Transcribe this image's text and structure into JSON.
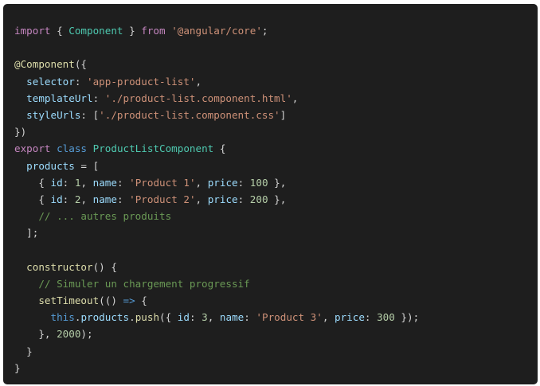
{
  "code_block": {
    "language": "typescript",
    "colors": {
      "background": "#1e1e1e",
      "keyword": "#569cd6",
      "control": "#c586c0",
      "class": "#4ec9b0",
      "function": "#dcdcaa",
      "string": "#ce9178",
      "number": "#b5cea8",
      "property": "#9cdcfe",
      "comment": "#6a9955",
      "punctuation": "#d4d4d4"
    },
    "lines": [
      [
        [
          "control",
          "import"
        ],
        [
          "punct",
          " { "
        ],
        [
          "class",
          "Component"
        ],
        [
          "punct",
          " } "
        ],
        [
          "control",
          "from"
        ],
        [
          "punct",
          " "
        ],
        [
          "string",
          "'@angular/core'"
        ],
        [
          "punct",
          ";"
        ]
      ],
      [],
      [
        [
          "func",
          "@Component"
        ],
        [
          "punct",
          "({"
        ]
      ],
      [
        [
          "punct",
          "  "
        ],
        [
          "prop",
          "selector"
        ],
        [
          "punct",
          ": "
        ],
        [
          "string",
          "'app-product-list'"
        ],
        [
          "punct",
          ","
        ]
      ],
      [
        [
          "punct",
          "  "
        ],
        [
          "prop",
          "templateUrl"
        ],
        [
          "punct",
          ": "
        ],
        [
          "string",
          "'./product-list.component.html'"
        ],
        [
          "punct",
          ","
        ]
      ],
      [
        [
          "punct",
          "  "
        ],
        [
          "prop",
          "styleUrls"
        ],
        [
          "punct",
          ": ["
        ],
        [
          "string",
          "'./product-list.component.css'"
        ],
        [
          "punct",
          "]"
        ]
      ],
      [
        [
          "punct",
          "})"
        ]
      ],
      [
        [
          "control",
          "export"
        ],
        [
          "punct",
          " "
        ],
        [
          "keyword",
          "class"
        ],
        [
          "punct",
          " "
        ],
        [
          "class",
          "ProductListComponent"
        ],
        [
          "punct",
          " {"
        ]
      ],
      [
        [
          "punct",
          "  "
        ],
        [
          "prop",
          "products"
        ],
        [
          "punct",
          " = ["
        ]
      ],
      [
        [
          "punct",
          "    { "
        ],
        [
          "prop",
          "id"
        ],
        [
          "punct",
          ": "
        ],
        [
          "number",
          "1"
        ],
        [
          "punct",
          ", "
        ],
        [
          "prop",
          "name"
        ],
        [
          "punct",
          ": "
        ],
        [
          "string",
          "'Product 1'"
        ],
        [
          "punct",
          ", "
        ],
        [
          "prop",
          "price"
        ],
        [
          "punct",
          ": "
        ],
        [
          "number",
          "100"
        ],
        [
          "punct",
          " },"
        ]
      ],
      [
        [
          "punct",
          "    { "
        ],
        [
          "prop",
          "id"
        ],
        [
          "punct",
          ": "
        ],
        [
          "number",
          "2"
        ],
        [
          "punct",
          ", "
        ],
        [
          "prop",
          "name"
        ],
        [
          "punct",
          ": "
        ],
        [
          "string",
          "'Product 2'"
        ],
        [
          "punct",
          ", "
        ],
        [
          "prop",
          "price"
        ],
        [
          "punct",
          ": "
        ],
        [
          "number",
          "200"
        ],
        [
          "punct",
          " },"
        ]
      ],
      [
        [
          "punct",
          "    "
        ],
        [
          "comment",
          "// ... autres produits"
        ]
      ],
      [
        [
          "punct",
          "  ];"
        ]
      ],
      [],
      [
        [
          "punct",
          "  "
        ],
        [
          "func",
          "constructor"
        ],
        [
          "punct",
          "() {"
        ]
      ],
      [
        [
          "punct",
          "    "
        ],
        [
          "comment",
          "// Simuler un chargement progressif"
        ]
      ],
      [
        [
          "punct",
          "    "
        ],
        [
          "func",
          "setTimeout"
        ],
        [
          "punct",
          "(() "
        ],
        [
          "keyword",
          "=>"
        ],
        [
          "punct",
          " {"
        ]
      ],
      [
        [
          "punct",
          "      "
        ],
        [
          "keyword",
          "this"
        ],
        [
          "punct",
          "."
        ],
        [
          "prop",
          "products"
        ],
        [
          "punct",
          "."
        ],
        [
          "func",
          "push"
        ],
        [
          "punct",
          "({ "
        ],
        [
          "prop",
          "id"
        ],
        [
          "punct",
          ": "
        ],
        [
          "number",
          "3"
        ],
        [
          "punct",
          ", "
        ],
        [
          "prop",
          "name"
        ],
        [
          "punct",
          ": "
        ],
        [
          "string",
          "'Product 3'"
        ],
        [
          "punct",
          ", "
        ],
        [
          "prop",
          "price"
        ],
        [
          "punct",
          ": "
        ],
        [
          "number",
          "300"
        ],
        [
          "punct",
          " });"
        ]
      ],
      [
        [
          "punct",
          "    }, "
        ],
        [
          "number",
          "2000"
        ],
        [
          "punct",
          ");"
        ]
      ],
      [
        [
          "punct",
          "  }"
        ]
      ],
      [
        [
          "punct",
          "}"
        ]
      ]
    ]
  }
}
